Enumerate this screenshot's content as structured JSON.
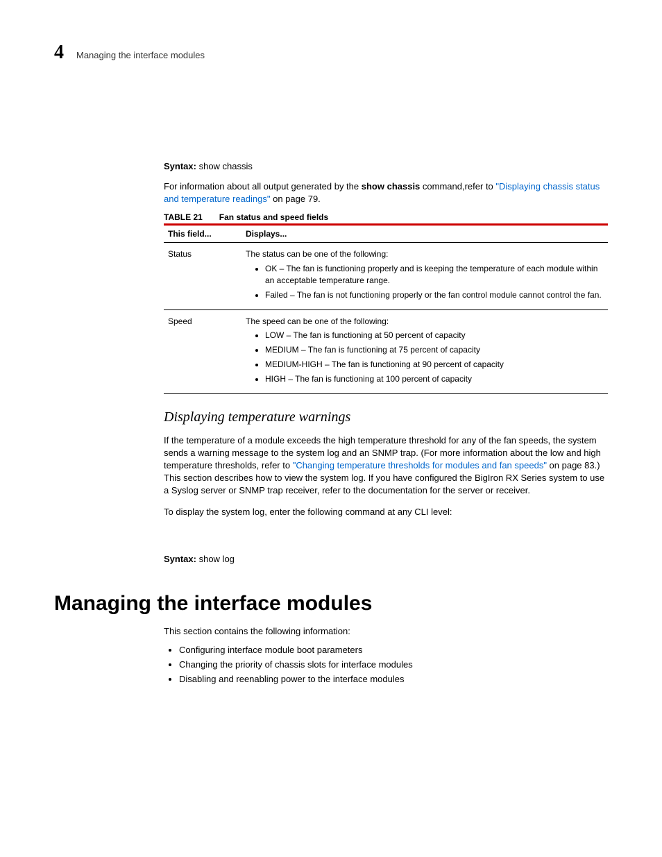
{
  "header": {
    "chapter_number": "4",
    "running_title": "Managing the interface modules"
  },
  "syntax1": {
    "label": "Syntax:",
    "command": "show chassis"
  },
  "intro_para": {
    "pre": "For information about all output generated by the ",
    "cmd": "show chassis",
    "mid": " command,refer to ",
    "link": "\"Displaying chassis status and temperature readings\"",
    "post": " on page 79."
  },
  "table": {
    "number": "TABLE 21",
    "title": "Fan status and speed fields",
    "head_col1": "This field...",
    "head_col2": "Displays...",
    "rows": [
      {
        "field": "Status",
        "intro": "The status can be one of the following:",
        "items": [
          "OK – The fan is functioning properly and is keeping the temperature of each module within an acceptable temperature range.",
          "Failed – The fan is not functioning properly or the fan control module cannot control the fan."
        ]
      },
      {
        "field": "Speed",
        "intro": "The speed can be one of the following:",
        "items": [
          "LOW – The fan is functioning at 50 percent of capacity",
          "MEDIUM – The fan is functioning at 75 percent of capacity",
          "MEDIUM-HIGH – The fan is functioning at 90 percent of capacity",
          "HIGH – The fan is functioning at 100 percent of capacity"
        ]
      }
    ]
  },
  "subheading": "Displaying temperature warnings",
  "warn_para": {
    "pre": " If the temperature of a module exceeds the high temperature threshold for any of the fan speeds, the system sends a warning message to the system log and an SNMP trap. (For more information about the low and high temperature thresholds, refer to ",
    "link": "\"Changing temperature thresholds for modules and fan speeds\"",
    "post": " on page 83.) This section describes how to view the system log. If you have configured the BigIron RX Series system to use a Syslog server or SNMP trap receiver, refer to the documentation for the server or receiver."
  },
  "display_log_para": "To display the system log, enter the following command at any CLI level:",
  "syntax2": {
    "label": "Syntax:",
    "command": "show log"
  },
  "section_heading": "Managing the interface modules",
  "section_intro": "This section contains the following information:",
  "section_items": [
    "Configuring interface module boot parameters",
    "Changing the priority of chassis slots for interface modules",
    "Disabling and reenabling power to the interface modules"
  ]
}
